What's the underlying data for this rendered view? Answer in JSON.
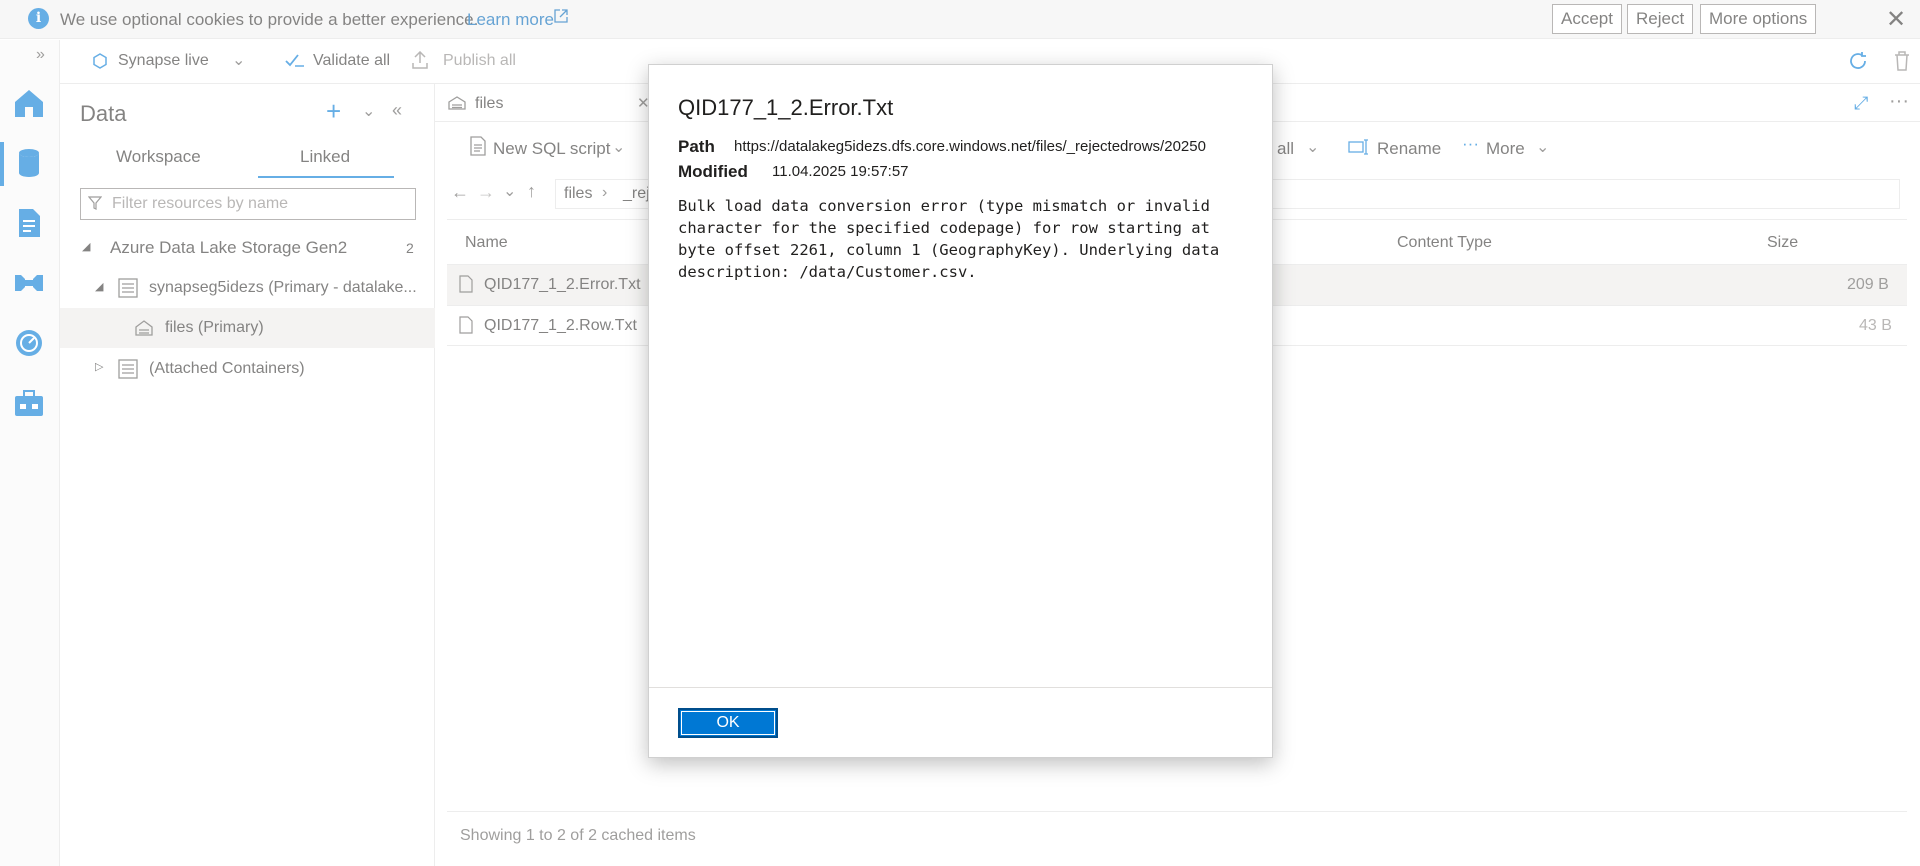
{
  "cookie_banner": {
    "message": "We use optional cookies to provide a better experience.",
    "learn_more": "Learn more",
    "accept": "Accept",
    "reject": "Reject",
    "more_options": "More options"
  },
  "toolbar": {
    "synapse_live": "Synapse live",
    "validate_all": "Validate all",
    "publish_all": "Publish all"
  },
  "data_panel": {
    "title": "Data",
    "tabs": [
      "Workspace",
      "Linked"
    ],
    "active_tab": "Linked",
    "filter_placeholder": "Filter resources by name",
    "tree": {
      "group_label": "Azure Data Lake Storage Gen2",
      "group_count": "2",
      "account": "synapseg5idezs (Primary - datalake...",
      "container": "files (Primary)",
      "attached": "(Attached Containers)"
    }
  },
  "editor": {
    "tab_label": "files",
    "new_sql_script": "New SQL script",
    "select_all_fragment": "all",
    "rename": "Rename",
    "more": "More",
    "breadcrumb": [
      "files",
      "_rej"
    ],
    "columns": [
      "Name",
      "Content Type",
      "Size"
    ],
    "rows": [
      {
        "name": "QID177_1_2.Error.Txt",
        "size": "209 B"
      },
      {
        "name": "QID177_1_2.Row.Txt",
        "size": "43 B"
      }
    ],
    "status": "Showing 1 to 2 of 2 cached items"
  },
  "dialog": {
    "title": "QID177_1_2.Error.Txt",
    "path_label": "Path",
    "path_value": "https://datalakeg5idezs.dfs.core.windows.net/files/_rejectedrows/20250",
    "modified_label": "Modified",
    "modified_value": "11.04.2025 19:57:57",
    "body": "Bulk load data conversion error (type mismatch or invalid\ncharacter for the specified codepage) for row starting at\nbyte offset 2261, column 1 (GeographyKey). Underlying data\ndescription: /data/Customer.csv.",
    "ok": "OK"
  },
  "colors": {
    "accent": "#0078d4",
    "link": "#0067b8"
  }
}
